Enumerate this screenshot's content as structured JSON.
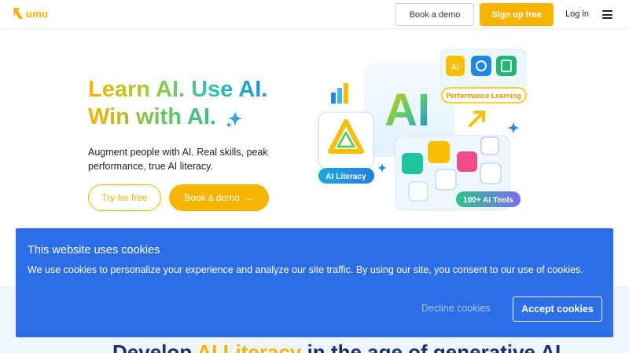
{
  "header": {
    "logo_text": "umu",
    "book_demo_label": "Book a demo",
    "signup_label": "Sign up free",
    "login_label": "Log in"
  },
  "hero": {
    "title_line1": "Learn AI. Use AI.",
    "title_line2": "Win with AI.",
    "subtitle": "Augment people with AI. Real skills, peak performance, true AI literacy.",
    "try_label": "Try for free",
    "book_demo_label": "Book a demo",
    "book_demo_arrow": "→"
  },
  "illustration": {
    "center_text": "AI",
    "badge_literacy": "AI Literacy",
    "badge_performance": "Performance Learning",
    "badge_tools": "100+ AI Tools",
    "small_ai_tile": "AI"
  },
  "cookie_banner": {
    "title": "This website uses cookies",
    "text": "We use cookies to personalize your experience and analyze our site traffic. By using our site, you consent to our use of cookies.",
    "decline_label": "Decline cookies",
    "accept_label": "Accept cookies"
  },
  "section": {
    "title_pre": "Develop ",
    "title_highlight": "AI Literacy",
    "title_post": " in the age of generative AI"
  },
  "colors": {
    "brand_yellow": "#f7b500",
    "cookie_blue": "#2b6ee6",
    "navy": "#1a2f6a"
  }
}
